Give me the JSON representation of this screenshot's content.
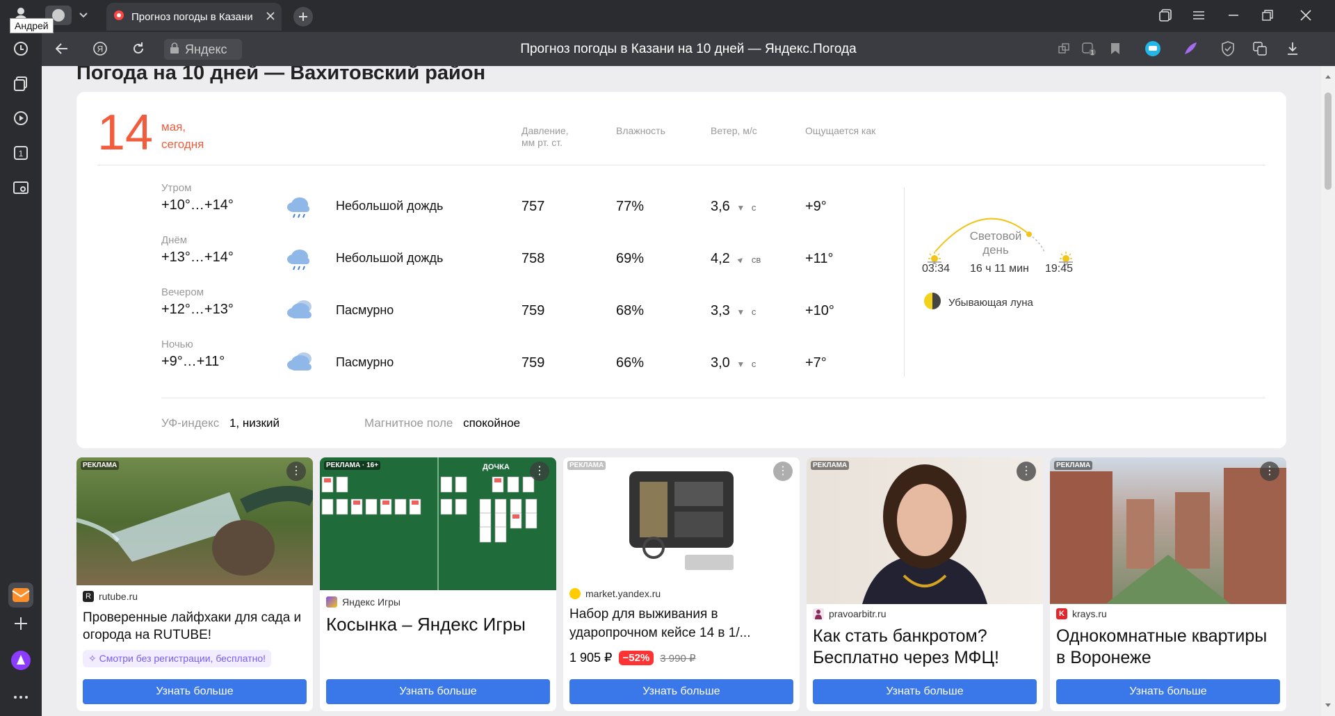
{
  "browser": {
    "profile_tooltip": "Андрей",
    "tab_title": "Прогноз погоды в Казани",
    "address_chip": "Яндекс",
    "page_title": "Прогноз погоды в Казани на 10 дней — Яндекс.Погода"
  },
  "weather": {
    "heading": "Погода на 10 дней — Вахитовский район",
    "day_number": "14",
    "day_month": "мая,",
    "day_label": "сегодня",
    "headers": {
      "pressure_line1": "Давление,",
      "pressure_line2": "мм рт. ст.",
      "humidity": "Влажность",
      "wind": "Ветер, м/с",
      "feels": "Ощущается как"
    },
    "rows": [
      {
        "period": "Утром",
        "temp": "+10°…+14°",
        "condition": "Небольшой дождь",
        "icon": "rain-cloud-icon",
        "pressure": "757",
        "humidity": "77%",
        "wind_speed": "3,6",
        "wind_dir": "с",
        "feels": "+9°"
      },
      {
        "period": "Днём",
        "temp": "+13°…+14°",
        "condition": "Небольшой дождь",
        "icon": "rain-cloud-icon",
        "pressure": "758",
        "humidity": "69%",
        "wind_speed": "4,2",
        "wind_dir": "св",
        "feels": "+11°"
      },
      {
        "period": "Вечером",
        "temp": "+12°…+13°",
        "condition": "Пасмурно",
        "icon": "overcast-cloud-icon",
        "pressure": "759",
        "humidity": "68%",
        "wind_speed": "3,3",
        "wind_dir": "с",
        "feels": "+10°"
      },
      {
        "period": "Ночью",
        "temp": "+9°…+11°",
        "condition": "Пасмурно",
        "icon": "overcast-cloud-icon",
        "pressure": "759",
        "humidity": "66%",
        "wind_speed": "3,0",
        "wind_dir": "с",
        "feels": "+7°"
      }
    ],
    "daylight": {
      "label_line1": "Световой",
      "label_line2": "день",
      "sunrise": "03:34",
      "duration": "16 ч 11 мин",
      "sunset": "19:45",
      "moon": "Убывающая луна"
    },
    "uv_label": "УФ-индекс",
    "uv_value": "1, низкий",
    "magnetic_label": "Магнитное поле",
    "magnetic_value": "спокойное"
  },
  "ads": [
    {
      "badge": "РЕКЛАМА",
      "domain": "rutube.ru",
      "title": "Проверенные лайфхаки для сада и огорода на RUTUBE!",
      "promo": "✧ Смотри без регистрации, бесплатно!",
      "button": "Узнать больше"
    },
    {
      "badge": "РЕКЛАМА · 16+",
      "domain": "Яндекс Игры",
      "title": "Косынка – Яндекс Игры",
      "game_label": "ДОЧКА",
      "button": "Узнать больше"
    },
    {
      "badge": "РЕКЛАМА",
      "domain": "market.yandex.ru",
      "title": "Набор для выживания в ударопрочном кейсе 14 в 1/...",
      "price": "1 905 ₽",
      "discount": "−52%",
      "old_price": "3 990 ₽",
      "button": "Узнать больше"
    },
    {
      "badge": "РЕКЛАМА",
      "domain": "pravoarbitr.ru",
      "title": "Как стать банкротом? Бесплатно через МФЦ!",
      "button": "Узнать больше"
    },
    {
      "badge": "РЕКЛАМА",
      "domain": "krays.ru",
      "title": "Однокомнатные квартиры в Воронеже",
      "button": "Узнать больше"
    }
  ]
}
